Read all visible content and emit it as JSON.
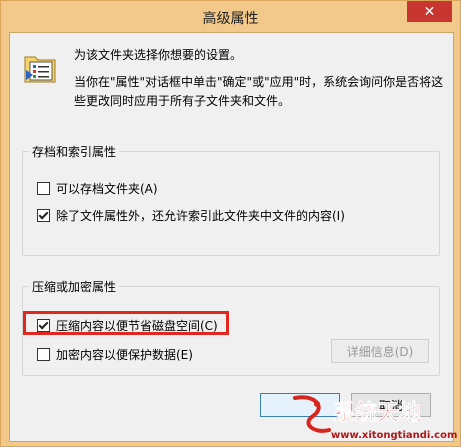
{
  "window": {
    "title": "高级属性",
    "close_glyph": "✕"
  },
  "description": {
    "line1": "为该文件夹选择你想要的设置。",
    "line2": "当你在\"属性\"对话框中单击\"确定\"或\"应用\"时，系统会询问你是否将这些更改同时应用于所有子文件夹和文件。"
  },
  "archive_group": {
    "title": "存档和索引属性",
    "archive": {
      "label": "可以存档文件夹(A)",
      "checked": false
    },
    "index": {
      "label": "除了文件属性外，还允许索引此文件夹中文件的内容(I)",
      "checked": true
    }
  },
  "compress_group": {
    "title": "压缩或加密属性",
    "compress": {
      "label": "压缩内容以便节省磁盘空间(C)",
      "checked": true
    },
    "encrypt": {
      "label": "加密内容以便保护数据(E)",
      "checked": false
    },
    "details_label": "详细信息(D)"
  },
  "buttons": {
    "ok_label": "",
    "cancel_label": "取消"
  },
  "watermark": {
    "text": "系统天地",
    "url": "www.xitongtiandi.com"
  },
  "colors": {
    "frame": "#f2c98a",
    "close": "#c7372f",
    "highlight": "#e0281e",
    "watermark_red": "#d7261e"
  }
}
